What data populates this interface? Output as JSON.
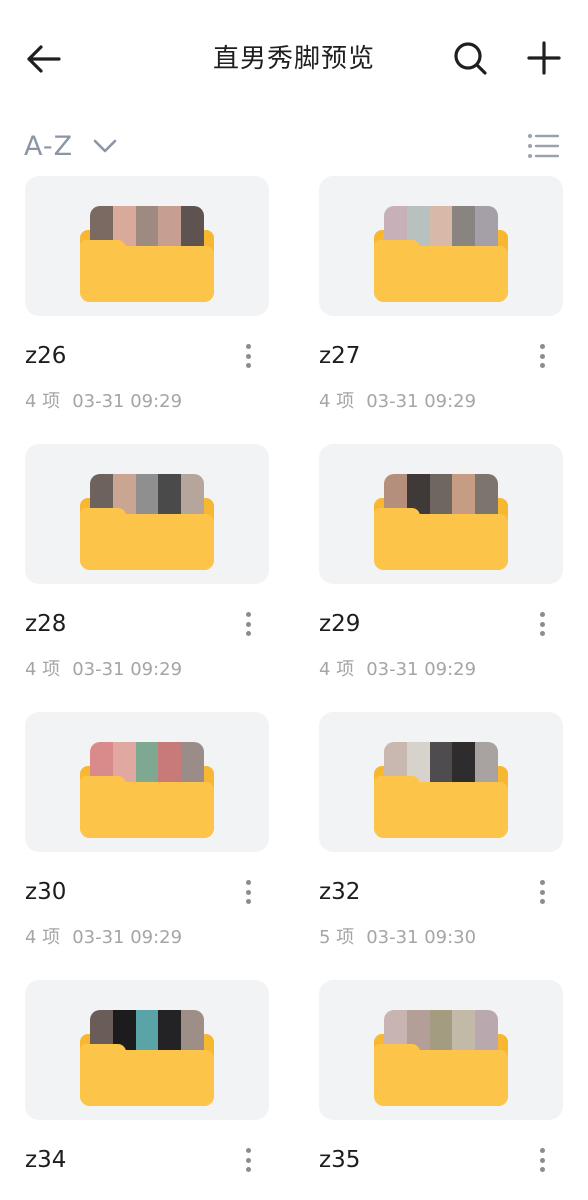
{
  "header": {
    "title": "直男秀脚预览",
    "back_icon": "arrow-left-icon",
    "search_icon": "search-icon",
    "add_icon": "plus-icon"
  },
  "sort": {
    "label": "A-Z",
    "chevron_icon": "chevron-down-icon",
    "view_icon": "list-view-icon"
  },
  "colors": {
    "folder": "#fdc44a",
    "folder_back": "#f7b731",
    "card_bg": "#f2f3f5",
    "sort_text": "#8a95a5"
  },
  "folders": [
    {
      "name": "z26",
      "count": "4 项",
      "date": "03-31 09:29"
    },
    {
      "name": "z27",
      "count": "4 项",
      "date": "03-31 09:29"
    },
    {
      "name": "z28",
      "count": "4 项",
      "date": "03-31 09:29"
    },
    {
      "name": "z29",
      "count": "4 项",
      "date": "03-31 09:29"
    },
    {
      "name": "z30",
      "count": "4 项",
      "date": "03-31 09:29"
    },
    {
      "name": "z32",
      "count": "5 项",
      "date": "03-31 09:30"
    },
    {
      "name": "z34",
      "count": "",
      "date": ""
    },
    {
      "name": "z35",
      "count": "",
      "date": ""
    }
  ]
}
